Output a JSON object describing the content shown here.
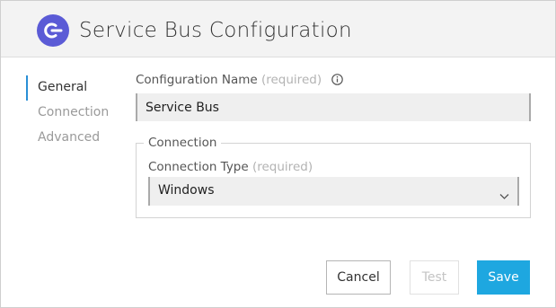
{
  "dialog": {
    "title": "Service Bus Configuration",
    "logo_icon": "plug-connector-icon",
    "accent_color": "#5b5bd6"
  },
  "nav": {
    "items": [
      {
        "label": "General",
        "active": true
      },
      {
        "label": "Connection",
        "active": false
      },
      {
        "label": "Advanced",
        "active": false
      }
    ],
    "active_color": "#2a8fd6"
  },
  "form": {
    "config_name": {
      "label": "Configuration Name",
      "required_text": "(required)",
      "info_icon": "info-circle-icon",
      "value": "Service Bus"
    },
    "connection": {
      "legend": "Connection",
      "type_label": "Connection Type",
      "required_text": "(required)",
      "selected": "Windows",
      "dropdown_icon": "chevron-down-icon"
    }
  },
  "buttons": {
    "cancel": "Cancel",
    "test": "Test",
    "save": "Save",
    "save_color": "#1ea7e0"
  }
}
